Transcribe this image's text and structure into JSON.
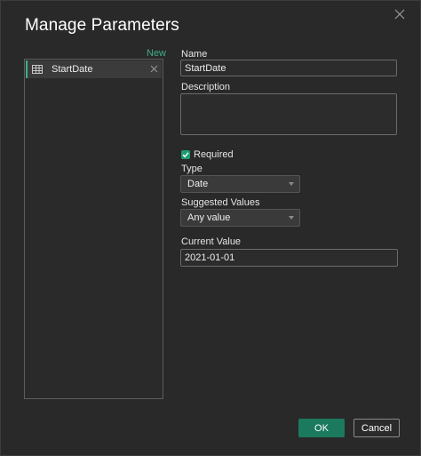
{
  "dialog": {
    "title": "Manage Parameters"
  },
  "sidebar": {
    "new_label": "New",
    "items": [
      {
        "label": "StartDate",
        "icon": "table-icon"
      }
    ]
  },
  "form": {
    "name_label": "Name",
    "name_value": "StartDate",
    "description_label": "Description",
    "description_value": "",
    "required_label": "Required",
    "required_checked": true,
    "type_label": "Type",
    "type_value": "Date",
    "suggested_label": "Suggested Values",
    "suggested_value": "Any value",
    "current_label": "Current Value",
    "current_value": "2021-01-01"
  },
  "buttons": {
    "ok_label": "OK",
    "cancel_label": "Cancel"
  },
  "colors": {
    "accent": "#1b7a5d",
    "link": "#3fae8b",
    "checkbox": "#1f9c72"
  }
}
